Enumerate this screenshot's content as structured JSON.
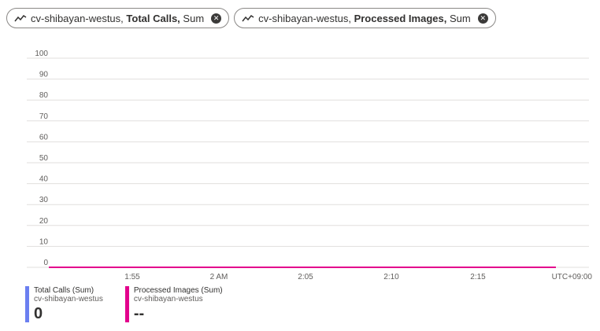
{
  "pills": [
    {
      "resource": "cv-shibayan-westus,",
      "metric": "Total Calls,",
      "agg": "Sum"
    },
    {
      "resource": "cv-shibayan-westus,",
      "metric": "Processed Images,",
      "agg": "Sum"
    }
  ],
  "legend": [
    {
      "title": "Total Calls (Sum)",
      "sub": "cv-shibayan-westus",
      "value": "0",
      "color": "#6b7ff0"
    },
    {
      "title": "Processed Images (Sum)",
      "sub": "cv-shibayan-westus",
      "value": "--",
      "color": "#e3008c"
    }
  ],
  "chart_data": {
    "type": "line",
    "ylim": [
      0,
      100
    ],
    "yticks": [
      0,
      10,
      20,
      30,
      40,
      50,
      60,
      70,
      80,
      90,
      100
    ],
    "xticks": [
      "1:55",
      "2 AM",
      "2:05",
      "2:10",
      "2:15"
    ],
    "timezone_label": "UTC+09:00",
    "grid": true,
    "series": [
      {
        "name": "Processed Images (Sum)",
        "color": "#e3008c",
        "values": [
          0,
          0
        ]
      }
    ]
  }
}
